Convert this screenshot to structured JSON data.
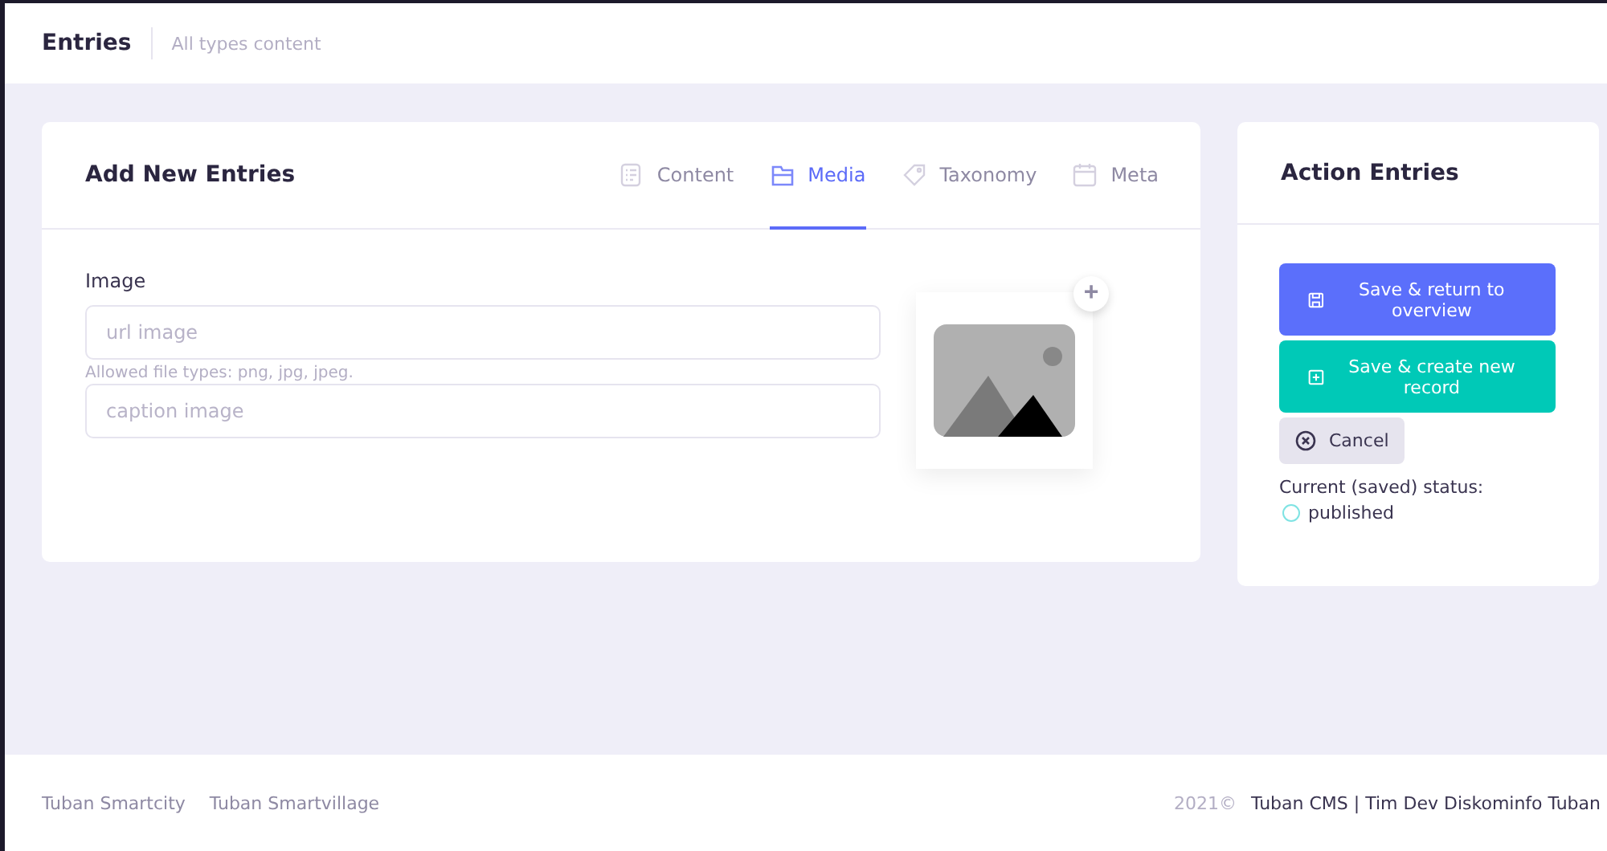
{
  "header": {
    "title": "Entries",
    "subtitle": "All types content"
  },
  "form_card": {
    "title": "Add New Entries",
    "tabs": [
      {
        "label": "Content",
        "kind": "content",
        "selected": false
      },
      {
        "label": "Media",
        "kind": "media",
        "selected": true
      },
      {
        "label": "Taxonomy",
        "kind": "tag",
        "selected": false
      },
      {
        "label": "Meta",
        "kind": "calendar",
        "selected": false
      }
    ],
    "image_label": "Image",
    "url_field": {
      "placeholder": "url image"
    },
    "hint": "Allowed file types: png, jpg, jpeg.",
    "caption_field": {
      "placeholder": "caption image"
    },
    "add_button": "+"
  },
  "action_card": {
    "title": "Action Entries",
    "buttons": [
      {
        "label": "Save & return to overview",
        "kind": "save"
      },
      {
        "label": "Save & create new record",
        "kind": "create"
      },
      {
        "label": "Cancel",
        "kind": "cancel"
      }
    ],
    "status_label": "Current (saved) status:",
    "status": {
      "label": "published",
      "color": "#7fe3e3"
    }
  },
  "footer": {
    "links": [
      "Tuban Smartcity",
      "Tuban Smartvillage"
    ],
    "year": "2021©",
    "credit": "Tuban CMS | Tim Dev Diskominfo Tuban"
  }
}
